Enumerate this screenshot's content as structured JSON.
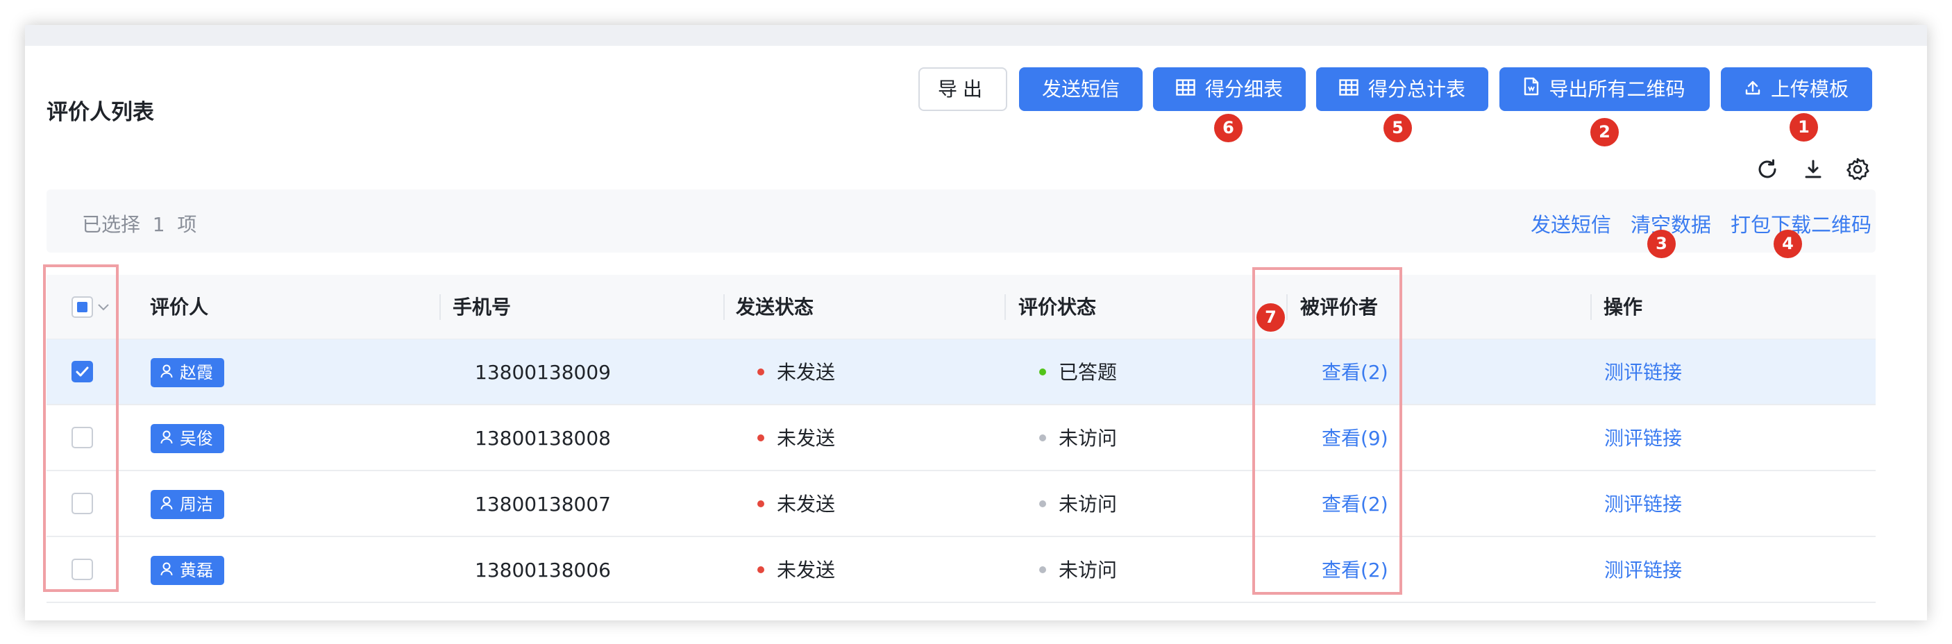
{
  "page": {
    "title": "评价人列表"
  },
  "toolbar": {
    "export": "导出",
    "send_sms": "发送短信",
    "score_detail": "得分细表",
    "score_total": "得分总计表",
    "export_qr": "导出所有二维码",
    "upload_template": "上传模板"
  },
  "selection": {
    "text": "已选择  1  项",
    "send_sms": "发送短信",
    "clear_data": "清空数据",
    "download_qr": "打包下载二维码"
  },
  "markers": [
    "1",
    "2",
    "3",
    "4",
    "5",
    "6",
    "7"
  ],
  "table": {
    "columns": [
      "评价人",
      "手机号",
      "发送状态",
      "评价状态",
      "被评价者",
      "操作"
    ],
    "rows": [
      {
        "name": "赵霞",
        "phone": "13800138009",
        "send_status": "未发送",
        "eval_status": "已答题",
        "evaluatee": "查看(2)",
        "action": "测评链接",
        "checked": true
      },
      {
        "name": "吴俊",
        "phone": "13800138008",
        "send_status": "未发送",
        "eval_status": "未访问",
        "evaluatee": "查看(9)",
        "action": "测评链接",
        "checked": false
      },
      {
        "name": "周洁",
        "phone": "13800138007",
        "send_status": "未发送",
        "eval_status": "未访问",
        "evaluatee": "查看(2)",
        "action": "测评链接",
        "checked": false
      },
      {
        "name": "黄磊",
        "phone": "13800138006",
        "send_status": "未发送",
        "eval_status": "未访问",
        "evaluatee": "查看(2)",
        "action": "测评链接",
        "checked": false
      }
    ]
  },
  "colors": {
    "primary": "#3a7bf0",
    "marker": "#e03126",
    "highlight": "#f0a0a5",
    "status_red": "#e5483d",
    "status_green": "#52c41a",
    "status_gray": "#b8bcc4",
    "selected_row": "#e9f2fd"
  },
  "icons": {
    "table": "table-icon",
    "file": "file-icon",
    "upload": "upload-icon",
    "refresh": "refresh-icon",
    "density": "density-icon",
    "settings": "gear-icon",
    "user": "user-icon"
  }
}
